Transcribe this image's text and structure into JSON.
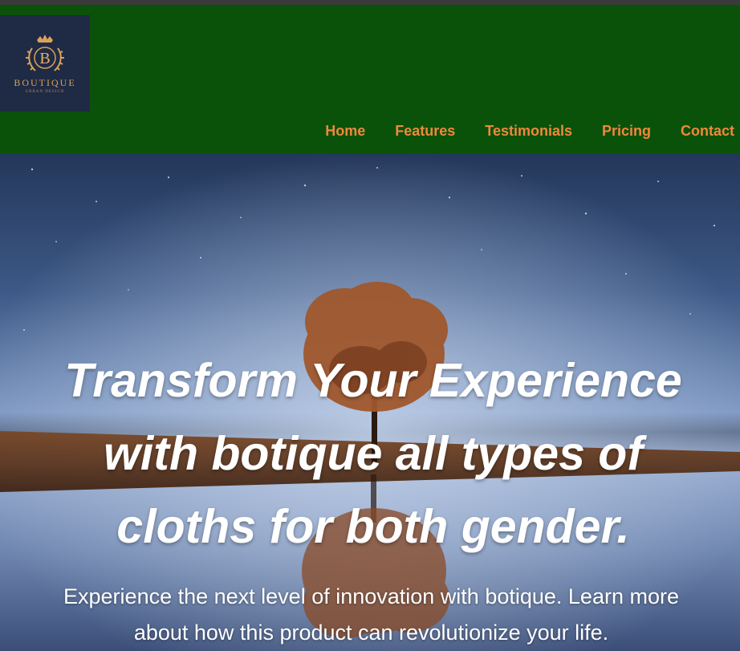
{
  "brand": {
    "logo_letter": "B",
    "logo_name": "BOUTIQUE",
    "logo_tagline": "URBAN DESIGN",
    "logo_color": "#d9a25b"
  },
  "colors": {
    "header_bg": "#0a5209",
    "nav_link": "#f0873c",
    "logo_bg": "#1f2a44"
  },
  "nav": {
    "items": [
      {
        "label": "Home"
      },
      {
        "label": "Features"
      },
      {
        "label": "Testimonials"
      },
      {
        "label": "Pricing"
      },
      {
        "label": "Contact"
      }
    ]
  },
  "hero": {
    "title": "Transform Your Experience with botique all types of cloths for both gender.",
    "subtitle": "Experience the next level of innovation with botique. Learn more about how this product can revolutionize your life."
  }
}
